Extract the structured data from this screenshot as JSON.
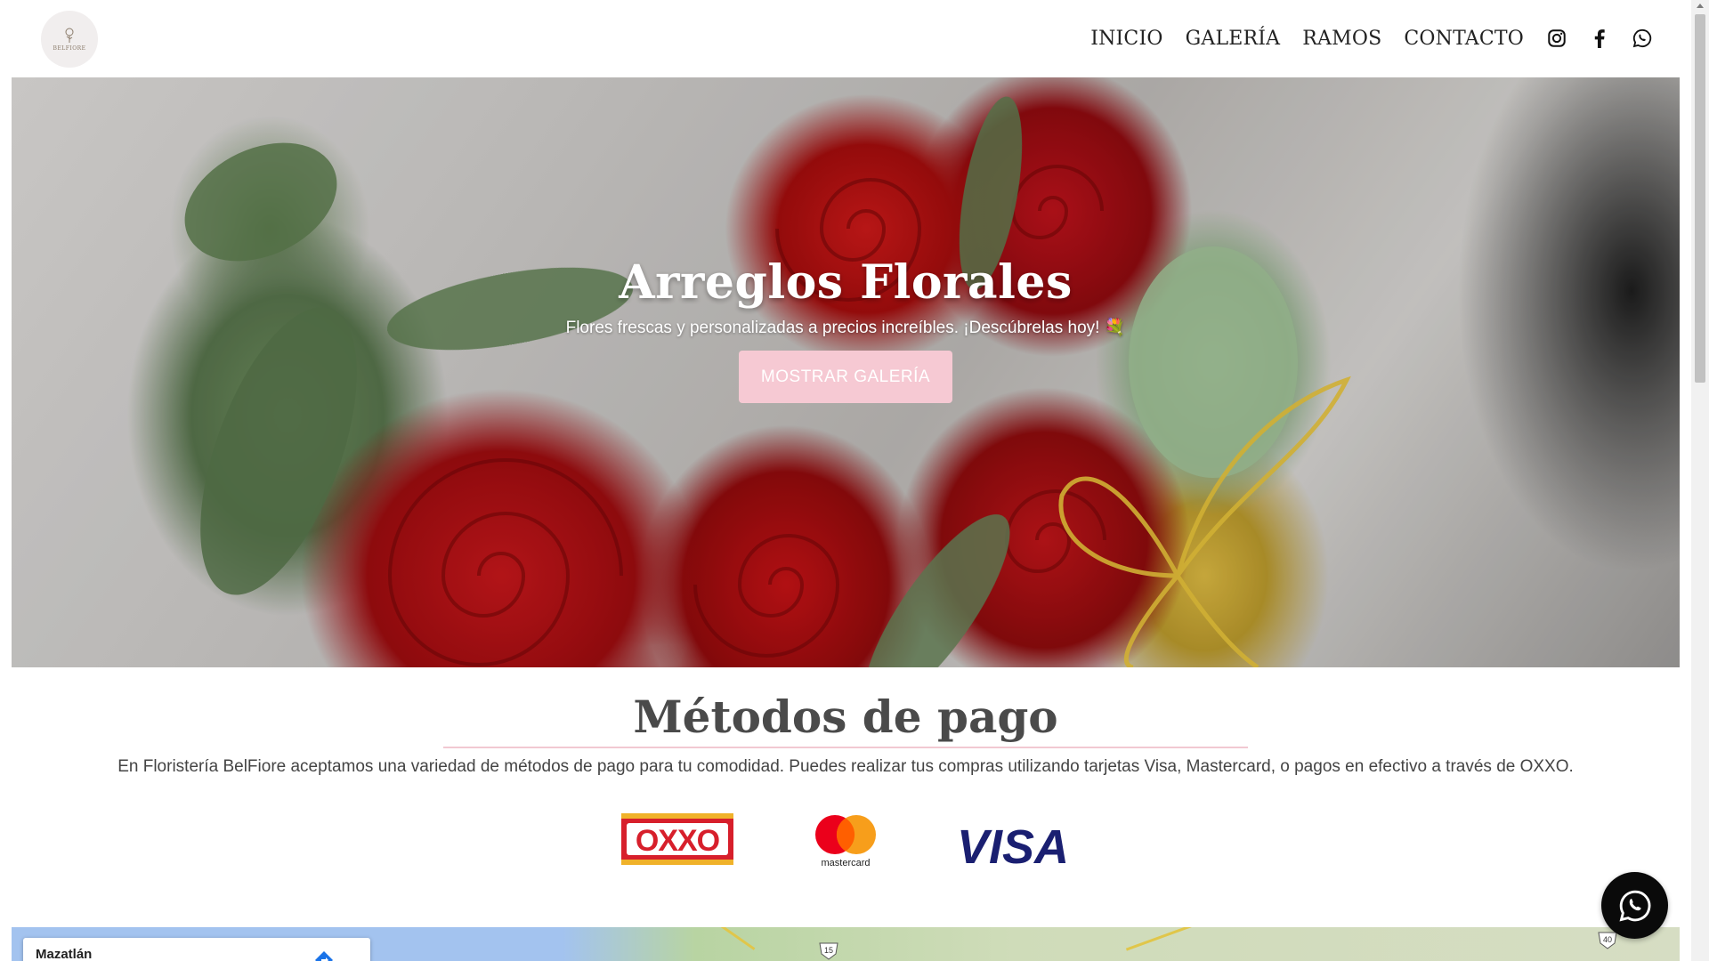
{
  "header": {
    "logo_text": "BELFIORE",
    "nav": [
      {
        "label": "INICIO"
      },
      {
        "label": "GALERÍA"
      },
      {
        "label": "RAMOS"
      },
      {
        "label": "CONTACTO"
      }
    ],
    "social": [
      "instagram-icon",
      "facebook-icon",
      "whatsapp-icon"
    ]
  },
  "hero": {
    "title": "Arreglos Florales",
    "subtitle": "Flores frescas y personalizadas a precios increíbles. ¡Descúbrelas hoy! 💐",
    "button_label": "MOSTRAR GALERÍA"
  },
  "payments": {
    "title": "Métodos de pago",
    "description": "En Floristería BelFiore aceptamos una variedad de métodos de pago para tu comodidad. Puedes realizar tus compras utilizando tarjetas Visa, Mastercard, o pagos en efectivo a través de OXXO.",
    "logos": [
      {
        "name": "OXXO"
      },
      {
        "name": "mastercard"
      },
      {
        "name": "VISA"
      }
    ]
  },
  "map": {
    "place": "Mazatlán",
    "road_labels": [
      "15",
      "40"
    ]
  },
  "colors": {
    "accent_pink": "#f6c9d3",
    "divider_pink": "#f2c9d2",
    "heading_gray": "#4a4a4a",
    "float_button": "#0a0a0a"
  }
}
